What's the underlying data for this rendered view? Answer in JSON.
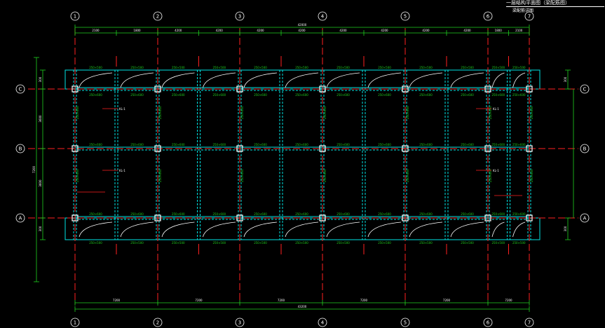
{
  "drawing": {
    "title": "一层结构平面图（梁配筋图）",
    "subtitle": "梁配筋详图"
  },
  "grid": {
    "columns": [
      "1",
      "2",
      "3",
      "4",
      "5",
      "6",
      "7"
    ],
    "rows": [
      "A",
      "B",
      "C"
    ]
  },
  "dimensions": {
    "top_spans": [
      "2100",
      "1800",
      "4200",
      "4200",
      "4200",
      "4200",
      "4200",
      "4200",
      "4200",
      "4200",
      "1800",
      "2100"
    ],
    "top_total": "42000",
    "bottom_spans": [
      "7200",
      "7200",
      "7200",
      "7200",
      "7200",
      "7200"
    ],
    "bottom_total": "43200",
    "left_segments": [
      "300",
      "3600",
      "3600",
      "300"
    ],
    "left_total": "7200",
    "right_segments": [
      "300",
      "300"
    ]
  },
  "labels": {
    "beam_top": "250×500",
    "beam_side": "250×600",
    "callout": "KL-1"
  },
  "colors": {
    "background": "#000000",
    "beam": "#00e5e5",
    "grid_red": "#ff2020",
    "dim_green": "#1fd11f",
    "column": "#ffffff",
    "text": "#ffffff"
  }
}
